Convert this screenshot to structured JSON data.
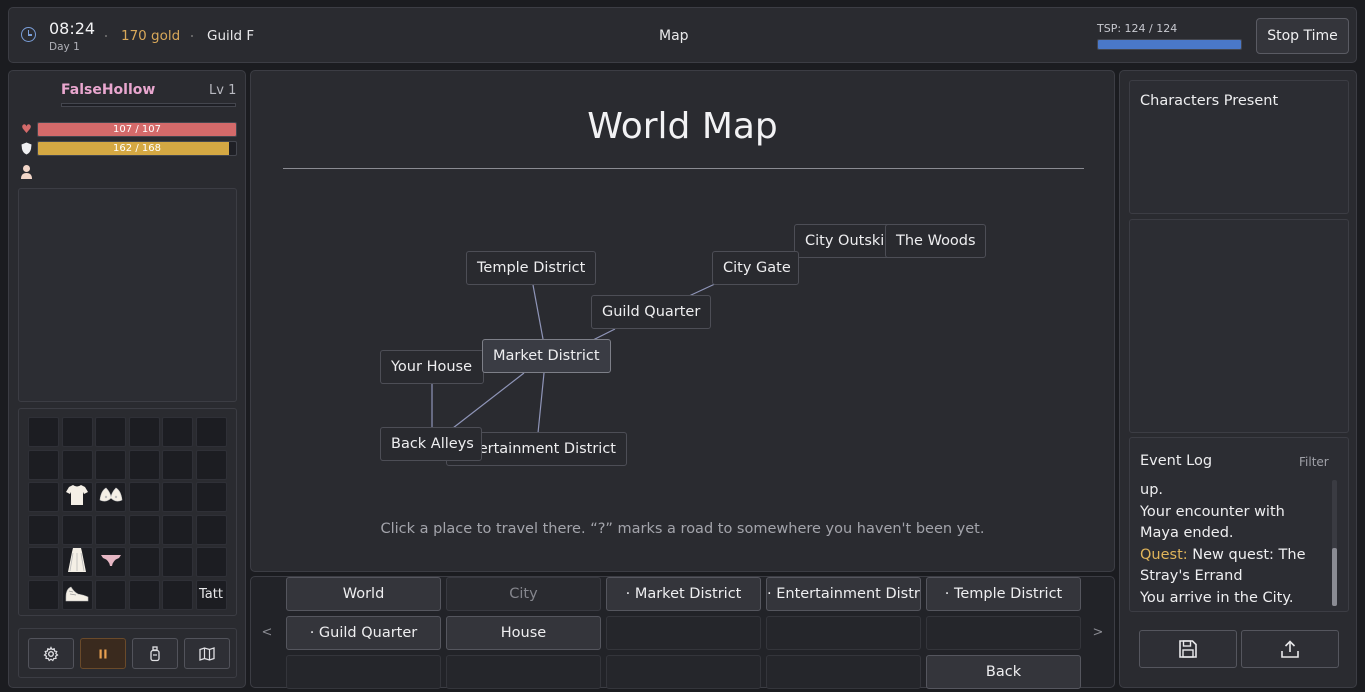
{
  "topbar": {
    "time": "08:24",
    "day": "Day 1",
    "gold": "170 gold",
    "guild": "Guild F",
    "screen_title": "Map",
    "tsp_label": "TSP: 124 / 124",
    "tsp_fraction": 1.0,
    "stop_time_label": "Stop Time",
    "colors": {
      "accent": "#4a78c8",
      "gold": "#d8a85a"
    }
  },
  "character": {
    "name": "FalseHollow",
    "level": "Lv 1",
    "hp": {
      "text": "107 / 107",
      "fraction": 1.0,
      "color": "#d46a6a"
    },
    "shield": {
      "text": "162 / 168",
      "fraction": 0.964,
      "color": "#d4a843"
    },
    "icons": [
      "heart-icon",
      "shield-icon",
      "person-icon"
    ]
  },
  "inventory": {
    "rows": [
      [
        "",
        "",
        "",
        "",
        "",
        ""
      ],
      [
        "",
        "",
        "",
        "",
        "",
        ""
      ],
      [
        "",
        "shirt-icon",
        "bra-icon",
        "",
        "",
        ""
      ],
      [
        "",
        "",
        "",
        "",
        "",
        ""
      ],
      [
        "",
        "skirt-icon",
        "panties-icon",
        "",
        "",
        ""
      ],
      [
        "",
        "shoes-icon",
        "",
        "",
        "",
        "Tatt"
      ]
    ],
    "controls": [
      "gear-icon",
      "pause-icon",
      "bottle-icon",
      "map-icon"
    ]
  },
  "map": {
    "title": "World Map",
    "hint": "Click a place to travel there.  “?” marks a road to somewhere you haven't been yet.",
    "nodes": {
      "temple": "Temple District",
      "city_gate": "City Gate",
      "outskirts": "City Outskirts",
      "woods": "The Woods",
      "guild": "Guild Quarter",
      "house": "Your House",
      "market": "Market District",
      "alleys": "Back Alleys",
      "entertainment": "Entertainment District"
    },
    "current": "market"
  },
  "nav": {
    "prev": "<",
    "next": ">",
    "buttons": {
      "world": "World",
      "city": "City",
      "market": "· Market District",
      "entertainment": "· Entertainment District",
      "temple": "· Temple District",
      "guild": "· Guild Quarter",
      "house": "House",
      "back": "Back"
    }
  },
  "right": {
    "characters_title": "Characters Present",
    "event_log_title": "Event Log",
    "filter_label": "Filter",
    "log": {
      "l1": "up.",
      "l2": "Your encounter with Maya ended.",
      "quest_tag": "Quest:",
      "l3": " New quest: The Stray's Errand",
      "l4": "You arrive in the City."
    },
    "buttons": [
      "save-icon",
      "export-icon"
    ]
  }
}
